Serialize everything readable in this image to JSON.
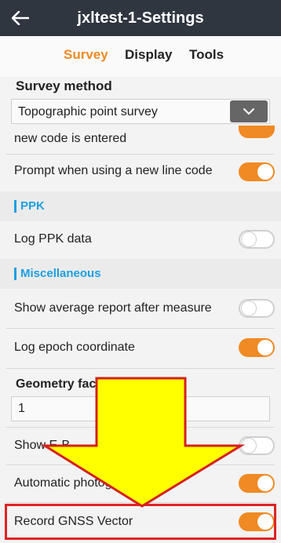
{
  "header": {
    "title": "jxltest-1-Settings"
  },
  "tabs": [
    {
      "label": "Survey",
      "active": true
    },
    {
      "label": "Display",
      "active": false
    },
    {
      "label": "Tools",
      "active": false
    }
  ],
  "survey_method": {
    "label": "Survey method",
    "value": "Topographic point survey"
  },
  "settings": [
    {
      "label": "new code is entered",
      "on": true
    },
    {
      "label": "Prompt when using a new line code",
      "on": true
    }
  ],
  "sections": {
    "ppk": "PPK",
    "misc": "Miscellaneous"
  },
  "ppk_items": [
    {
      "label": "Log PPK data",
      "on": false
    }
  ],
  "misc_items": [
    {
      "label": "Show average report after measure",
      "on": false
    },
    {
      "label": "Log epoch coordinate",
      "on": true
    }
  ],
  "geometry": {
    "label": "Geometry fac",
    "value": "1"
  },
  "lower_items": [
    {
      "label": "Show E-B",
      "on": false
    },
    {
      "label": "Automatic photog",
      "suffix": "g",
      "on": true
    },
    {
      "label": "Record GNSS Vector",
      "on": true
    }
  ],
  "colors": {
    "accent": "#f08a24",
    "section": "#1e9fe0",
    "titlebar": "#2f3640",
    "highlight": "#e02424",
    "arrow": "#ffff00"
  }
}
